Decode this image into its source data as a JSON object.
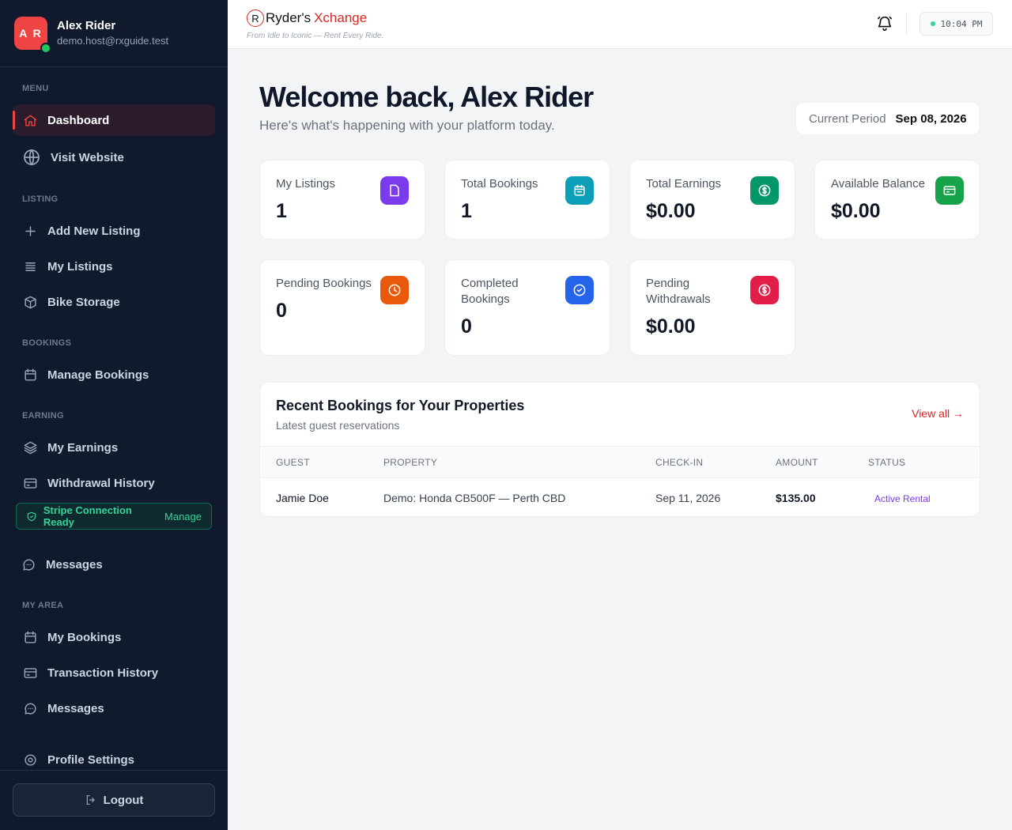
{
  "profile": {
    "initials": "A R",
    "name": "Alex Rider",
    "email": "demo.host@rxguide.test"
  },
  "sidebar": {
    "menu_label": "MENU",
    "dashboard": "Dashboard",
    "visit_website": "Visit Website",
    "listing_label": "LISTING",
    "add_listing": "Add New Listing",
    "my_listings": "My Listings",
    "bike_storage": "Bike Storage",
    "bookings_label": "BOOKINGS",
    "manage_bookings": "Manage Bookings",
    "earning_label": "EARNING",
    "my_earnings": "My Earnings",
    "withdrawal_history": "Withdrawal History",
    "stripe_status": "Stripe Connection Ready",
    "stripe_manage": "Manage",
    "messages_host": "Messages",
    "my_area_label": "MY AREA",
    "my_bookings": "My Bookings",
    "transaction_history": "Transaction History",
    "messages": "Messages",
    "profile_settings": "Profile Settings",
    "logout": "Logout"
  },
  "topbar": {
    "brand_mark": "R",
    "brand_name": "Ryder's",
    "brand_accent": "Xchange",
    "tagline": "From Idle to Iconic — Rent Every Ride.",
    "time": "10:04 PM"
  },
  "main": {
    "welcome": "Welcome back, Alex Rider",
    "subtitle": "Here's what's happening with your platform today.",
    "period_label": "Current Period",
    "period_value": "Sep 08, 2026"
  },
  "stats": [
    {
      "label": "My Listings",
      "value": "1",
      "icon": "document-icon",
      "color": "#7c3aed"
    },
    {
      "label": "Total Bookings",
      "value": "1",
      "icon": "calendar-icon",
      "color": "#0e9fb8"
    },
    {
      "label": "Total Earnings",
      "value": "$0.00",
      "icon": "dollar-icon",
      "color": "#059669"
    },
    {
      "label": "Available Balance",
      "value": "$0.00",
      "icon": "credit-card-icon",
      "color": "#16a34a"
    },
    {
      "label": "Pending Bookings",
      "value": "0",
      "icon": "clock-icon",
      "color": "#ea580c"
    },
    {
      "label": "Completed Bookings",
      "value": "0",
      "icon": "check-circle-icon",
      "color": "#2563eb"
    },
    {
      "label": "Pending Withdrawals",
      "value": "$0.00",
      "icon": "dollar-icon",
      "color": "#e11d48"
    }
  ],
  "recent_bookings": {
    "title": "Recent Bookings for Your Properties",
    "subtitle": "Latest guest reservations",
    "view_all": "View all →",
    "columns": [
      "GUEST",
      "PROPERTY",
      "CHECK-IN",
      "AMOUNT",
      "STATUS"
    ],
    "rows": [
      {
        "guest": "Jamie Doe",
        "property": "Demo: Honda CB500F — Perth CBD",
        "check_in": "Sep 11, 2026",
        "amount": "$135.00",
        "status": "Active Rental"
      }
    ]
  },
  "colors": {
    "accent": "#ef4444",
    "sidebar_bg": "#111a2c",
    "success": "#34d399"
  }
}
